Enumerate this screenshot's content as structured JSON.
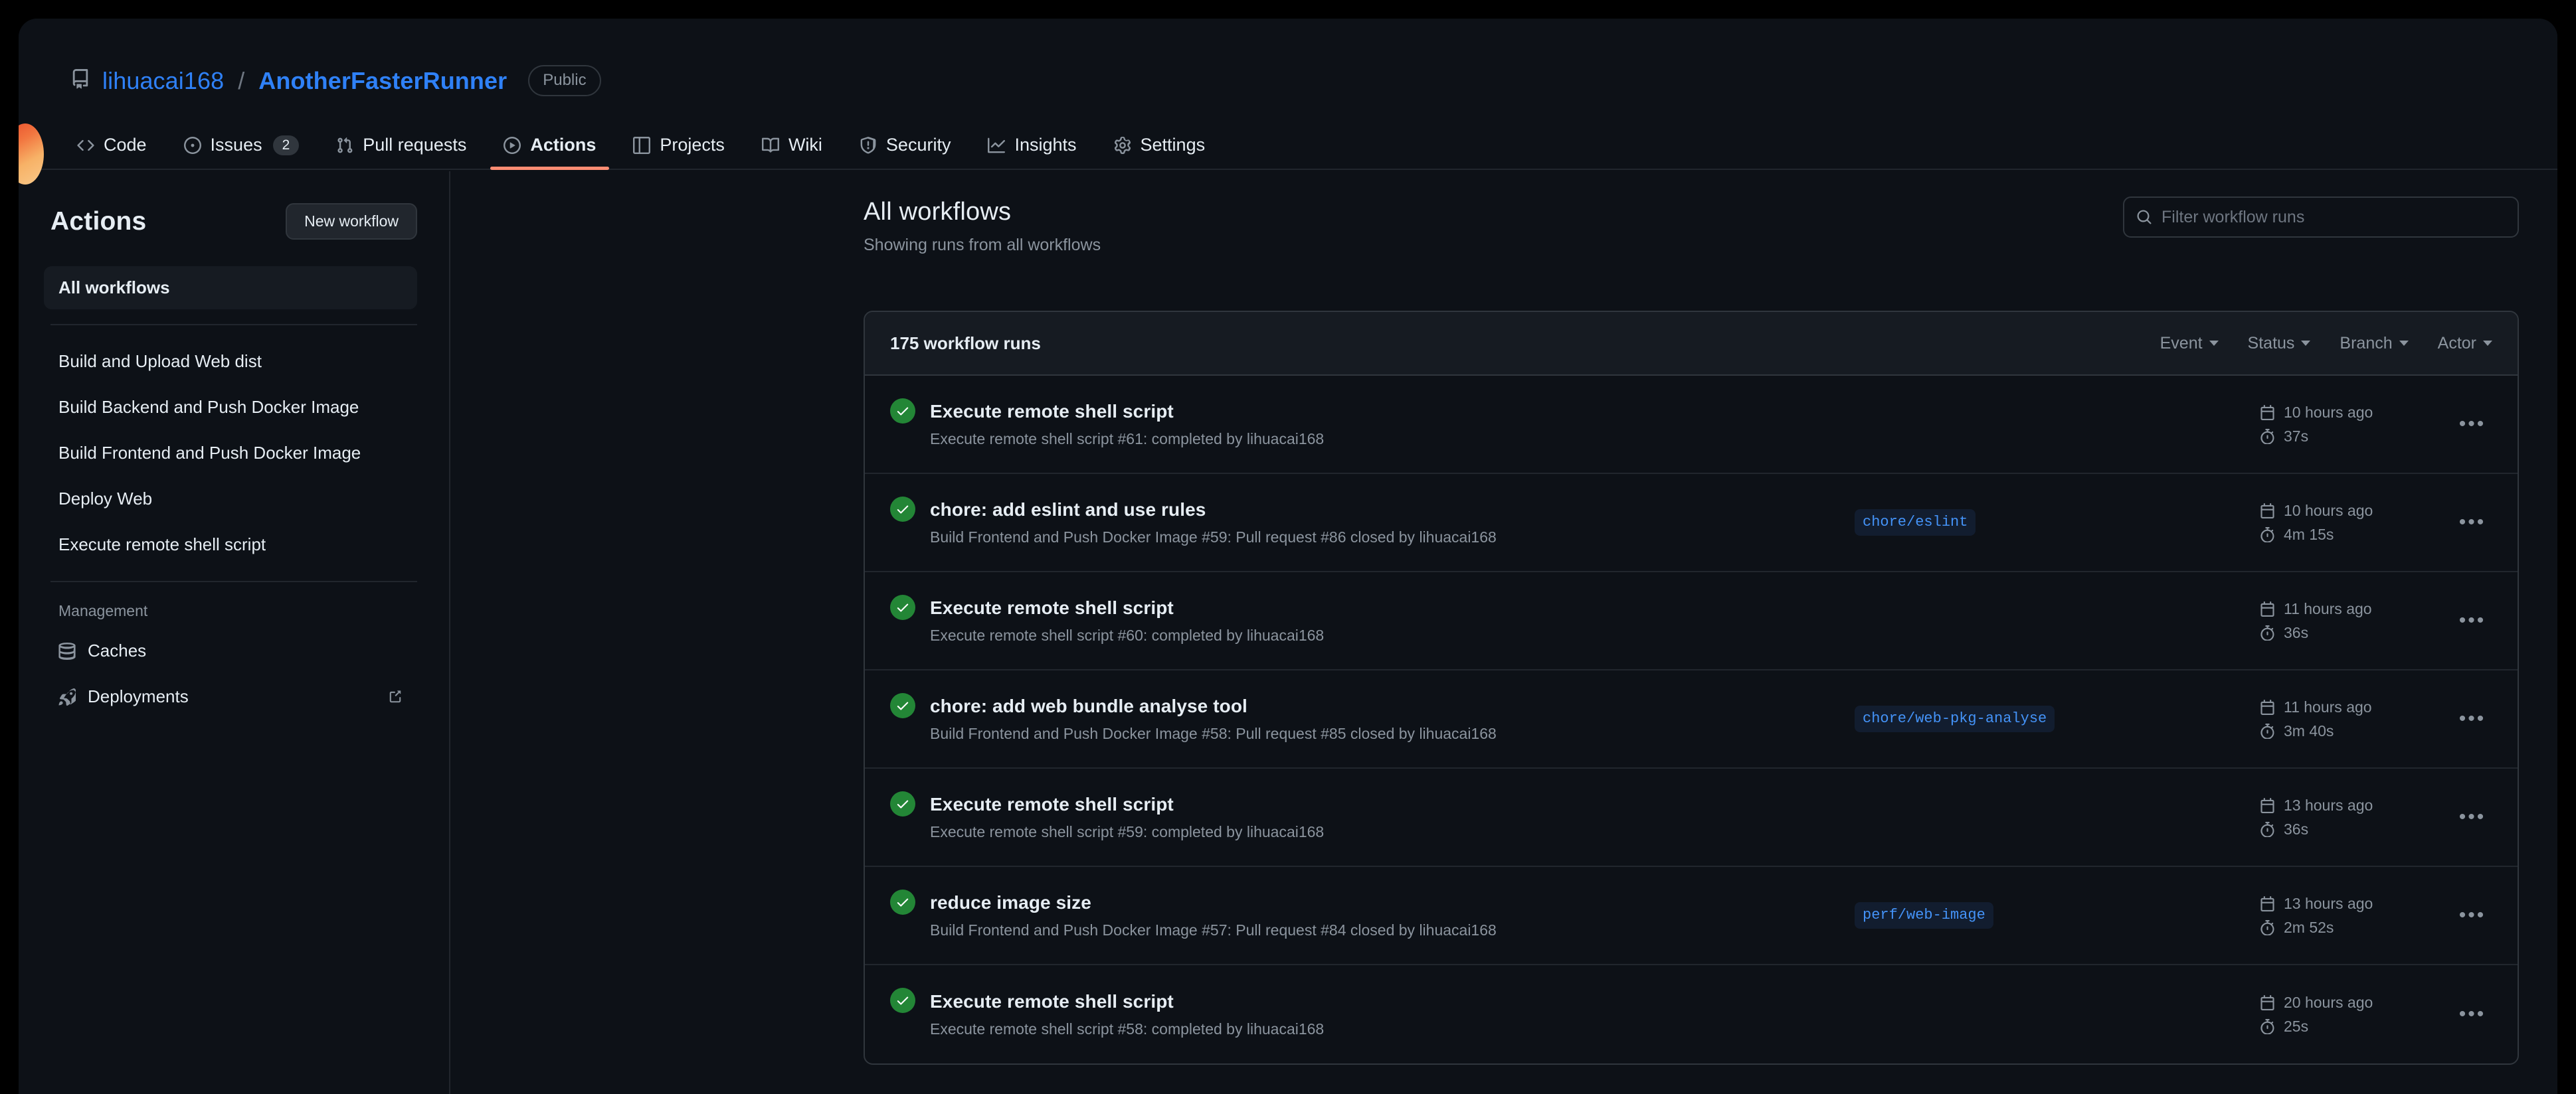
{
  "repo": {
    "owner": "lihuacai168",
    "name": "AnotherFasterRunner",
    "separator": "/",
    "visibility": "Public",
    "repo_icon": "repo-icon"
  },
  "nav": {
    "tabs": [
      {
        "label": "Code",
        "icon": "code-icon",
        "active": false,
        "counter": null
      },
      {
        "label": "Issues",
        "icon": "issue-icon",
        "active": false,
        "counter": "2"
      },
      {
        "label": "Pull requests",
        "icon": "git-pull-request-icon",
        "active": false,
        "counter": null
      },
      {
        "label": "Actions",
        "icon": "play-icon",
        "active": true,
        "counter": null
      },
      {
        "label": "Projects",
        "icon": "table-icon",
        "active": false,
        "counter": null
      },
      {
        "label": "Wiki",
        "icon": "book-icon",
        "active": false,
        "counter": null
      },
      {
        "label": "Security",
        "icon": "shield-icon",
        "active": false,
        "counter": null
      },
      {
        "label": "Insights",
        "icon": "graph-icon",
        "active": false,
        "counter": null
      },
      {
        "label": "Settings",
        "icon": "gear-icon",
        "active": false,
        "counter": null
      }
    ]
  },
  "sidebar": {
    "title": "Actions",
    "new_workflow_label": "New workflow",
    "all_workflows_label": "All workflows",
    "workflows": [
      "Build and Upload Web dist",
      "Build Backend and Push Docker Image",
      "Build Frontend and Push Docker Image",
      "Deploy Web",
      "Execute remote shell script"
    ],
    "management_label": "Management",
    "management_items": [
      {
        "label": "Caches",
        "icon": "cache-icon",
        "external": false
      },
      {
        "label": "Deployments",
        "icon": "rocket-icon",
        "external": true
      }
    ]
  },
  "main": {
    "title": "All workflows",
    "subtitle": "Showing runs from all workflows",
    "search": {
      "placeholder": "Filter workflow runs",
      "value": "",
      "icon": "search-icon"
    },
    "toolbar": {
      "count_label": "175 workflow runs",
      "filters": [
        "Event",
        "Status",
        "Branch",
        "Actor"
      ]
    },
    "runs": [
      {
        "status": "success",
        "title": "Execute remote shell script",
        "meta": "Execute remote shell script #61: completed by lihuacai168",
        "branch": "",
        "time": "10 hours ago",
        "duration": "37s"
      },
      {
        "status": "success",
        "title": "chore: add eslint and use rules",
        "meta": "Build Frontend and Push Docker Image #59: Pull request #86 closed by lihuacai168",
        "branch": "chore/eslint",
        "time": "10 hours ago",
        "duration": "4m 15s"
      },
      {
        "status": "success",
        "title": "Execute remote shell script",
        "meta": "Execute remote shell script #60: completed by lihuacai168",
        "branch": "",
        "time": "11 hours ago",
        "duration": "36s"
      },
      {
        "status": "success",
        "title": "chore: add web bundle analyse tool",
        "meta": "Build Frontend and Push Docker Image #58: Pull request #85 closed by lihuacai168",
        "branch": "chore/web-pkg-analyse",
        "time": "11 hours ago",
        "duration": "3m 40s"
      },
      {
        "status": "success",
        "title": "Execute remote shell script",
        "meta": "Execute remote shell script #59: completed by lihuacai168",
        "branch": "",
        "time": "13 hours ago",
        "duration": "36s"
      },
      {
        "status": "success",
        "title": "reduce image size",
        "meta": "Build Frontend and Push Docker Image #57: Pull request #84 closed by lihuacai168",
        "branch": "perf/web-image",
        "time": "13 hours ago",
        "duration": "2m 52s"
      },
      {
        "status": "success",
        "title": "Execute remote shell script",
        "meta": "Execute remote shell script #58: completed by lihuacai168",
        "branch": "",
        "time": "20 hours ago",
        "duration": "25s"
      }
    ],
    "kebab_label": "•••"
  },
  "colors": {
    "accent_blue": "#2f81f7",
    "active_tab_underline": "#fd8c73",
    "success_green": "#238636",
    "page_bg": "#0d1117",
    "panel_border": "#30363d",
    "muted_text": "#8b949e"
  }
}
